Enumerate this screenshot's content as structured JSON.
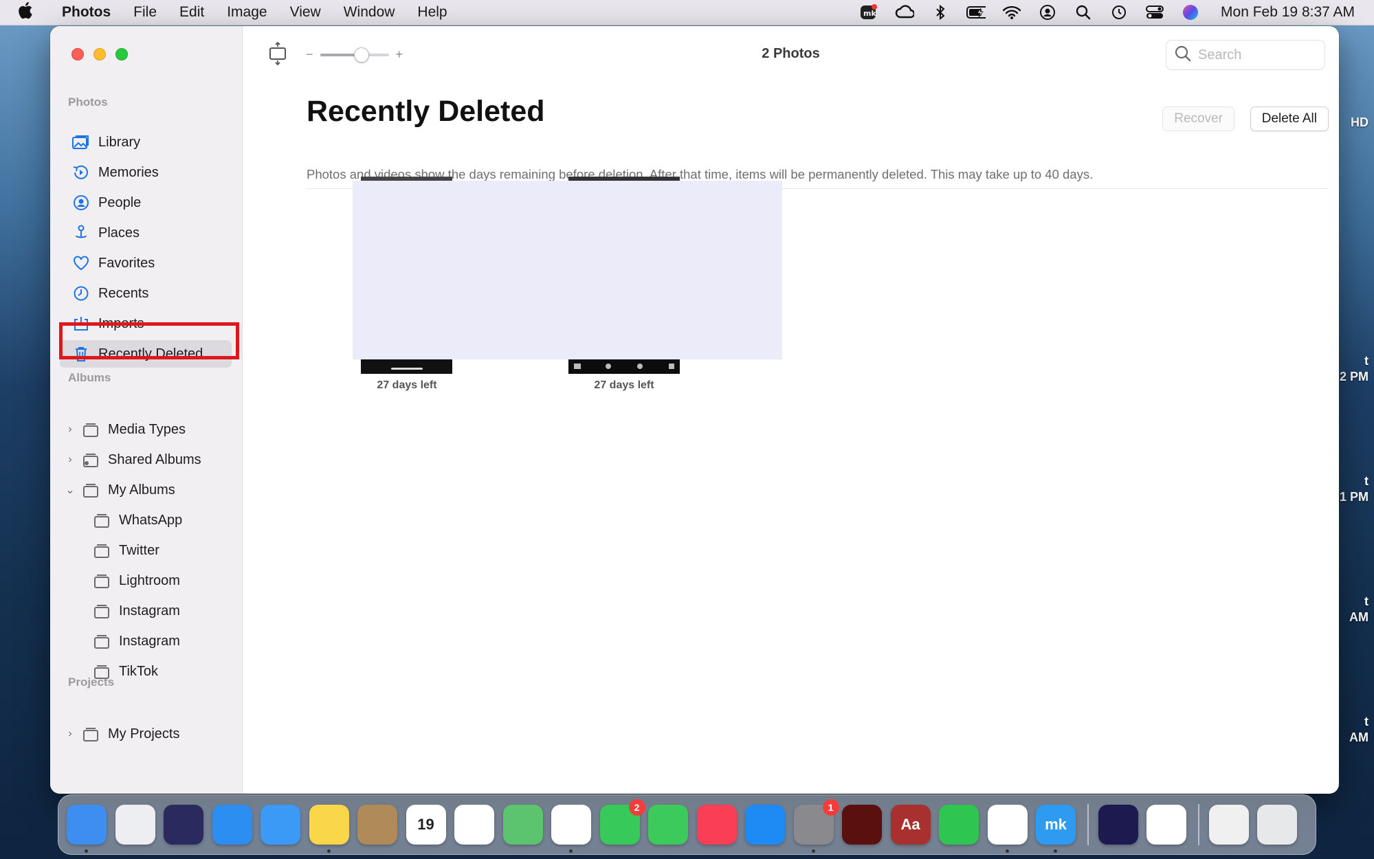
{
  "menubar": {
    "apple": "",
    "app_name": "Photos",
    "menus": [
      "File",
      "Edit",
      "Image",
      "View",
      "Window",
      "Help"
    ],
    "clock": "Mon Feb 19  8:37 AM"
  },
  "desktop": {
    "labels": [
      "HD",
      "t",
      "2 PM",
      "t",
      "1 PM",
      "t",
      "AM",
      "t",
      "AM"
    ]
  },
  "sidebar": {
    "sections": {
      "photos": "Photos",
      "albums": "Albums",
      "projects": "Projects"
    },
    "items": [
      {
        "label": "Library",
        "icon": "library-icon"
      },
      {
        "label": "Memories",
        "icon": "memories-icon"
      },
      {
        "label": "People",
        "icon": "people-icon"
      },
      {
        "label": "Places",
        "icon": "places-icon"
      },
      {
        "label": "Favorites",
        "icon": "heart-icon"
      },
      {
        "label": "Recents",
        "icon": "clock-icon"
      },
      {
        "label": "Imports",
        "icon": "import-icon"
      },
      {
        "label": "Recently Deleted",
        "icon": "trash-icon",
        "selected": true
      }
    ],
    "albums": [
      {
        "label": "Media Types",
        "chevron": "›"
      },
      {
        "label": "Shared Albums",
        "chevron": "›"
      },
      {
        "label": "My Albums",
        "chevron": "⌄"
      },
      {
        "label": "WhatsApp"
      },
      {
        "label": "Twitter"
      },
      {
        "label": "Lightroom"
      },
      {
        "label": "Instagram"
      },
      {
        "label": "Instagram"
      },
      {
        "label": "TikTok"
      }
    ],
    "projects": [
      {
        "label": "My Projects",
        "chevron": "›"
      }
    ]
  },
  "toolbar": {
    "zoom_minus": "−",
    "zoom_plus": "+",
    "zoom_level": 0.6,
    "photo_count": "2 Photos",
    "search_placeholder": "Search"
  },
  "main": {
    "title": "Recently Deleted",
    "recover_label": "Recover",
    "delete_all_label": "Delete All",
    "subtitle": "Photos and videos show the days remaining before deletion. After that time, items will be permanently deleted. This may take up to 40 days.",
    "photos": [
      {
        "caption": "27 days left"
      },
      {
        "caption": "27 days left"
      }
    ]
  },
  "dock": {
    "apps": [
      {
        "name": "finder-icon",
        "color": "#3d8ef0"
      },
      {
        "name": "launchpad-icon",
        "color": "#eceef2"
      },
      {
        "name": "siri-icon",
        "color": "#2b2a5e"
      },
      {
        "name": "safari-icon",
        "color": "#2c8ef0"
      },
      {
        "name": "mail-icon",
        "color": "#3b9af5"
      },
      {
        "name": "notes-icon",
        "color": "#f9d64a"
      },
      {
        "name": "contacts-icon",
        "color": "#b18a5a"
      },
      {
        "name": "calendar-icon",
        "color": "#ffffff",
        "label": "19"
      },
      {
        "name": "reminders-icon",
        "color": "#ffffff"
      },
      {
        "name": "maps-icon",
        "color": "#5cc36e"
      },
      {
        "name": "photos-icon",
        "color": "#ffffff"
      },
      {
        "name": "facetime-icon",
        "color": "#38c95b",
        "badge": "2"
      },
      {
        "name": "messages-icon",
        "color": "#3ccb5a"
      },
      {
        "name": "music-icon",
        "color": "#fa3e55"
      },
      {
        "name": "app-store-icon",
        "color": "#1e8bf5"
      },
      {
        "name": "system-settings-icon",
        "color": "#8a8a8e",
        "badge": "1"
      },
      {
        "name": "flash-icon",
        "color": "#5b1010"
      },
      {
        "name": "dictionary-icon",
        "color": "#a8302e",
        "label": "Aa"
      },
      {
        "name": "whatsapp-icon",
        "color": "#2fc551"
      },
      {
        "name": "chrome-icon",
        "color": "#ffffff"
      },
      {
        "name": "mk-app-icon",
        "color": "#2e9bf0",
        "label": "mk"
      },
      {
        "name": "firefox-icon",
        "color": "#1c1a4f"
      },
      {
        "name": "opera-icon",
        "color": "#ffffff"
      },
      {
        "name": "downloads-stack-icon",
        "color": "#f0f0f0"
      },
      {
        "name": "trash-dock-icon",
        "color": "#e7e8ea"
      }
    ]
  }
}
